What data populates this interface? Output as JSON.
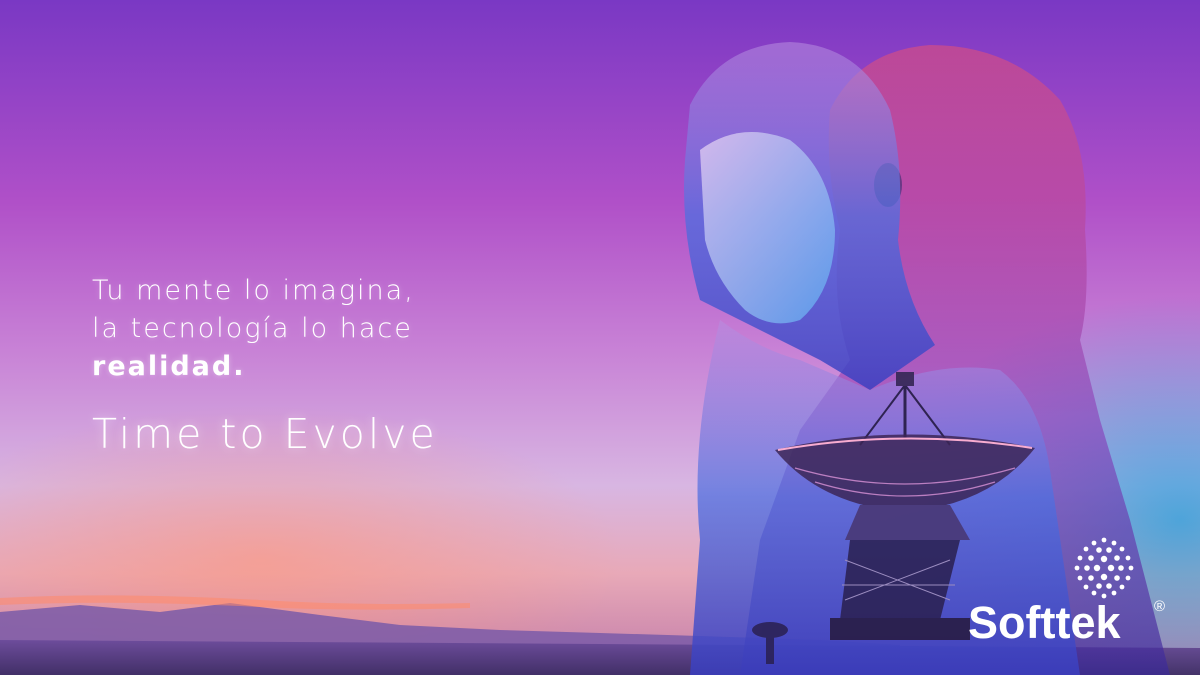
{
  "headline": {
    "line1": "Tu mente lo imagina,",
    "line2": "la tecnología lo hace",
    "line3": "realidad."
  },
  "tagline": "Time to Evolve",
  "logo": {
    "brand": "Softtek",
    "registered_mark": "®",
    "mark_icon": "dotted-circle-icon"
  },
  "colors": {
    "sky_top": "#7a38c4",
    "sky_mid": "#c882d6",
    "horizon": "#e8a9b8",
    "accent_blue": "#2aa0dc",
    "text": "#ffffff"
  }
}
